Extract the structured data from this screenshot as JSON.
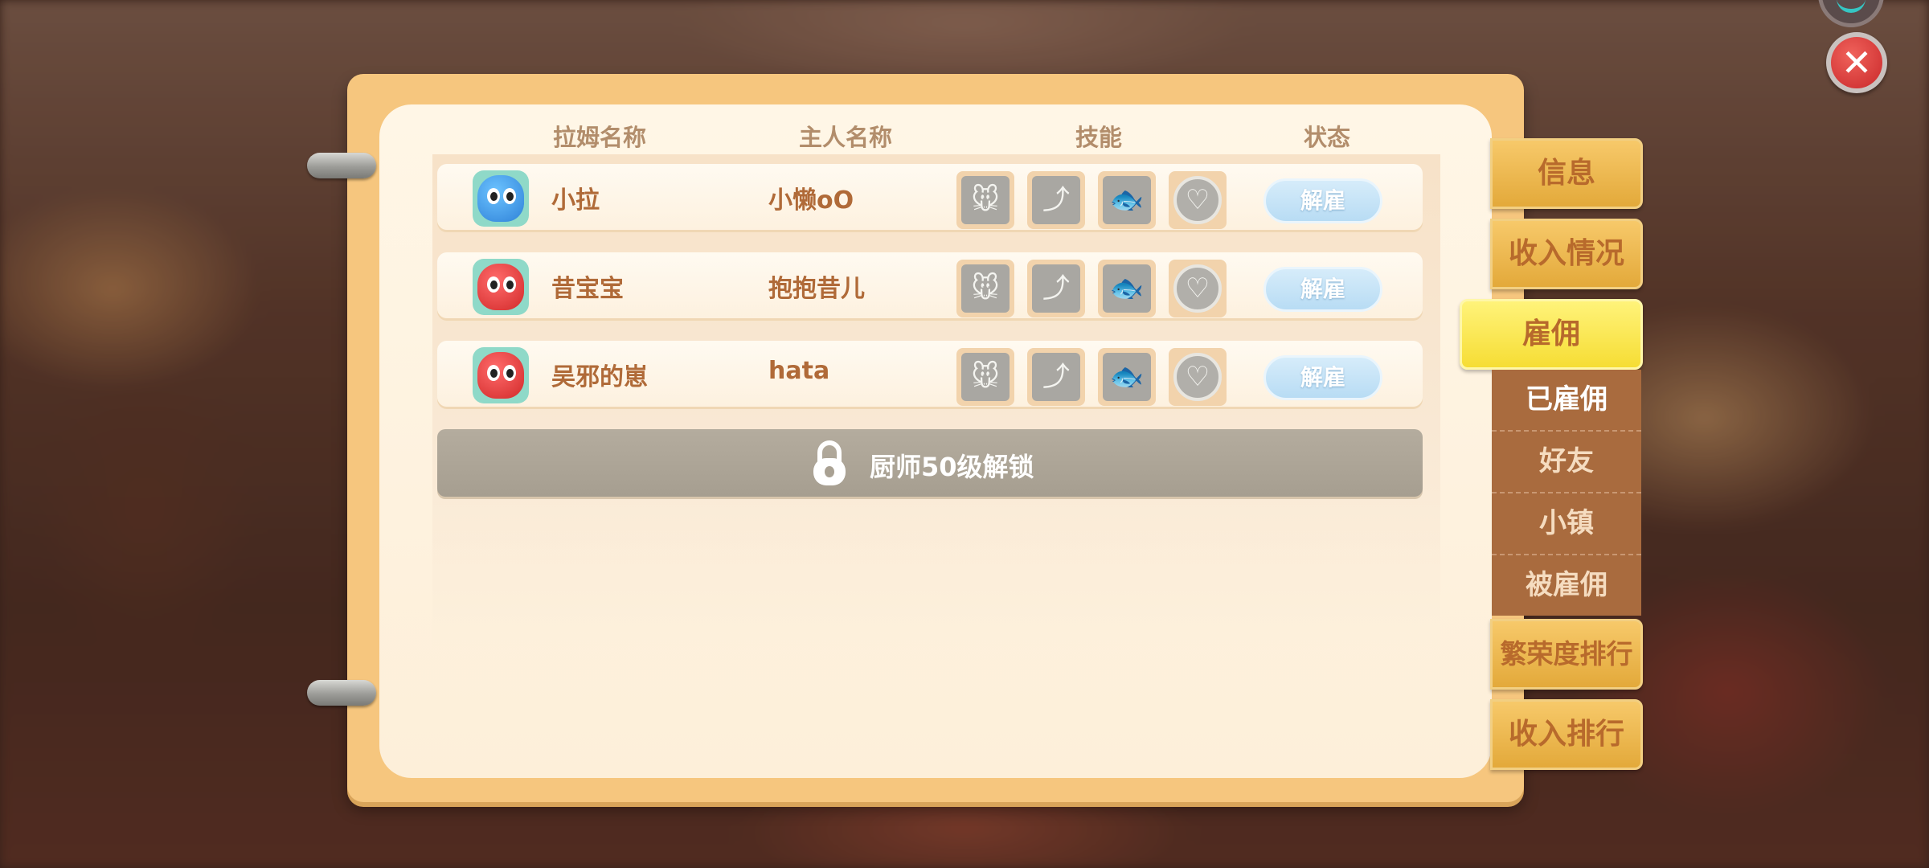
{
  "close_label": "✕",
  "headers": {
    "slime_name": "拉姆名称",
    "owner_name": "主人名称",
    "skills": "技能",
    "status": "状态"
  },
  "rows": [
    {
      "slime": "小拉",
      "owner": "小懒oO",
      "color": "blue",
      "status": "解雇"
    },
    {
      "slime": "昔宝宝",
      "owner": "抱抱昔儿",
      "color": "red",
      "status": "解雇"
    },
    {
      "slime": "吴邪的崽",
      "owner": "hata",
      "color": "red",
      "status": "解雇"
    }
  ],
  "skill_icons": [
    "mouse-skill-icon",
    "chart-notebook-skill-icon",
    "fish-magnifier-skill-icon",
    "heart-skill-icon"
  ],
  "lock_text": "厨师50级解锁",
  "tabs": {
    "info": "信息",
    "income": "收入情况",
    "hire": "雇佣",
    "prosperity": "繁荣度排行",
    "income_rank": "收入排行"
  },
  "submenu": {
    "hired": "已雇佣",
    "friends": "好友",
    "town": "小镇",
    "be_hired": "被雇佣"
  },
  "colors": {
    "book_frame": "#f6c67e",
    "active_tab": "#f6dd34",
    "tab": "#e3a93a",
    "submenu": "#a96b3e",
    "status_button": "#b8dcf4"
  }
}
